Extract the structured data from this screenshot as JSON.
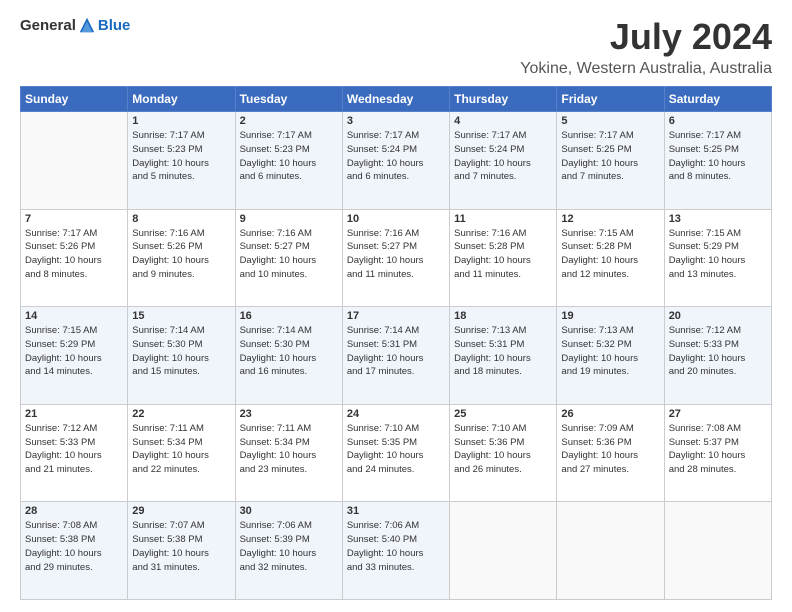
{
  "logo": {
    "general": "General",
    "blue": "Blue"
  },
  "header": {
    "title": "July 2024",
    "subtitle": "Yokine, Western Australia, Australia"
  },
  "days_of_week": [
    "Sunday",
    "Monday",
    "Tuesday",
    "Wednesday",
    "Thursday",
    "Friday",
    "Saturday"
  ],
  "weeks": [
    [
      {
        "day": "",
        "info": ""
      },
      {
        "day": "1",
        "info": "Sunrise: 7:17 AM\nSunset: 5:23 PM\nDaylight: 10 hours\nand 5 minutes."
      },
      {
        "day": "2",
        "info": "Sunrise: 7:17 AM\nSunset: 5:23 PM\nDaylight: 10 hours\nand 6 minutes."
      },
      {
        "day": "3",
        "info": "Sunrise: 7:17 AM\nSunset: 5:24 PM\nDaylight: 10 hours\nand 6 minutes."
      },
      {
        "day": "4",
        "info": "Sunrise: 7:17 AM\nSunset: 5:24 PM\nDaylight: 10 hours\nand 7 minutes."
      },
      {
        "day": "5",
        "info": "Sunrise: 7:17 AM\nSunset: 5:25 PM\nDaylight: 10 hours\nand 7 minutes."
      },
      {
        "day": "6",
        "info": "Sunrise: 7:17 AM\nSunset: 5:25 PM\nDaylight: 10 hours\nand 8 minutes."
      }
    ],
    [
      {
        "day": "7",
        "info": "Sunrise: 7:17 AM\nSunset: 5:26 PM\nDaylight: 10 hours\nand 8 minutes."
      },
      {
        "day": "8",
        "info": "Sunrise: 7:16 AM\nSunset: 5:26 PM\nDaylight: 10 hours\nand 9 minutes."
      },
      {
        "day": "9",
        "info": "Sunrise: 7:16 AM\nSunset: 5:27 PM\nDaylight: 10 hours\nand 10 minutes."
      },
      {
        "day": "10",
        "info": "Sunrise: 7:16 AM\nSunset: 5:27 PM\nDaylight: 10 hours\nand 11 minutes."
      },
      {
        "day": "11",
        "info": "Sunrise: 7:16 AM\nSunset: 5:28 PM\nDaylight: 10 hours\nand 11 minutes."
      },
      {
        "day": "12",
        "info": "Sunrise: 7:15 AM\nSunset: 5:28 PM\nDaylight: 10 hours\nand 12 minutes."
      },
      {
        "day": "13",
        "info": "Sunrise: 7:15 AM\nSunset: 5:29 PM\nDaylight: 10 hours\nand 13 minutes."
      }
    ],
    [
      {
        "day": "14",
        "info": "Sunrise: 7:15 AM\nSunset: 5:29 PM\nDaylight: 10 hours\nand 14 minutes."
      },
      {
        "day": "15",
        "info": "Sunrise: 7:14 AM\nSunset: 5:30 PM\nDaylight: 10 hours\nand 15 minutes."
      },
      {
        "day": "16",
        "info": "Sunrise: 7:14 AM\nSunset: 5:30 PM\nDaylight: 10 hours\nand 16 minutes."
      },
      {
        "day": "17",
        "info": "Sunrise: 7:14 AM\nSunset: 5:31 PM\nDaylight: 10 hours\nand 17 minutes."
      },
      {
        "day": "18",
        "info": "Sunrise: 7:13 AM\nSunset: 5:31 PM\nDaylight: 10 hours\nand 18 minutes."
      },
      {
        "day": "19",
        "info": "Sunrise: 7:13 AM\nSunset: 5:32 PM\nDaylight: 10 hours\nand 19 minutes."
      },
      {
        "day": "20",
        "info": "Sunrise: 7:12 AM\nSunset: 5:33 PM\nDaylight: 10 hours\nand 20 minutes."
      }
    ],
    [
      {
        "day": "21",
        "info": "Sunrise: 7:12 AM\nSunset: 5:33 PM\nDaylight: 10 hours\nand 21 minutes."
      },
      {
        "day": "22",
        "info": "Sunrise: 7:11 AM\nSunset: 5:34 PM\nDaylight: 10 hours\nand 22 minutes."
      },
      {
        "day": "23",
        "info": "Sunrise: 7:11 AM\nSunset: 5:34 PM\nDaylight: 10 hours\nand 23 minutes."
      },
      {
        "day": "24",
        "info": "Sunrise: 7:10 AM\nSunset: 5:35 PM\nDaylight: 10 hours\nand 24 minutes."
      },
      {
        "day": "25",
        "info": "Sunrise: 7:10 AM\nSunset: 5:36 PM\nDaylight: 10 hours\nand 26 minutes."
      },
      {
        "day": "26",
        "info": "Sunrise: 7:09 AM\nSunset: 5:36 PM\nDaylight: 10 hours\nand 27 minutes."
      },
      {
        "day": "27",
        "info": "Sunrise: 7:08 AM\nSunset: 5:37 PM\nDaylight: 10 hours\nand 28 minutes."
      }
    ],
    [
      {
        "day": "28",
        "info": "Sunrise: 7:08 AM\nSunset: 5:38 PM\nDaylight: 10 hours\nand 29 minutes."
      },
      {
        "day": "29",
        "info": "Sunrise: 7:07 AM\nSunset: 5:38 PM\nDaylight: 10 hours\nand 31 minutes."
      },
      {
        "day": "30",
        "info": "Sunrise: 7:06 AM\nSunset: 5:39 PM\nDaylight: 10 hours\nand 32 minutes."
      },
      {
        "day": "31",
        "info": "Sunrise: 7:06 AM\nSunset: 5:40 PM\nDaylight: 10 hours\nand 33 minutes."
      },
      {
        "day": "",
        "info": ""
      },
      {
        "day": "",
        "info": ""
      },
      {
        "day": "",
        "info": ""
      }
    ]
  ]
}
